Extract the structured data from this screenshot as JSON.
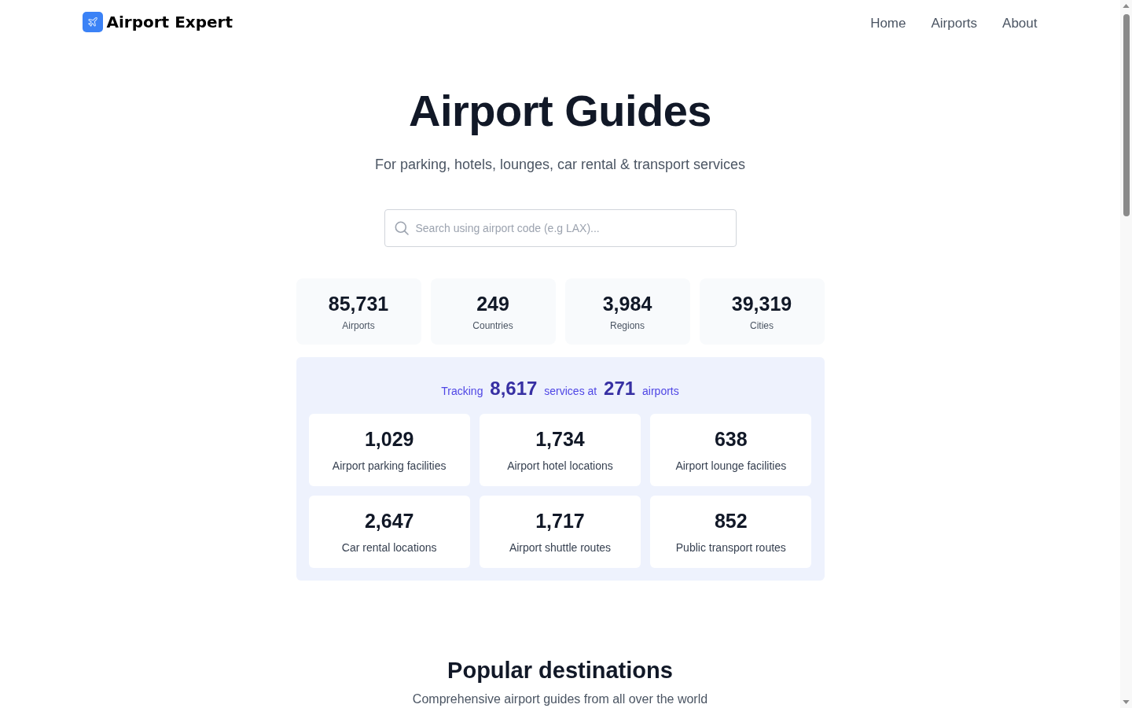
{
  "header": {
    "logo": {
      "text": "Airport Expert"
    },
    "nav": [
      {
        "label": "Home"
      },
      {
        "label": "Airports"
      },
      {
        "label": "About"
      }
    ]
  },
  "hero": {
    "title": "Airport Guides",
    "subtitle": "For parking, hotels, lounges, car rental & transport services",
    "search": {
      "placeholder": "Search using airport code (e.g LAX)..."
    }
  },
  "stats": [
    {
      "value": "85,731",
      "label": "Airports"
    },
    {
      "value": "249",
      "label": "Countries"
    },
    {
      "value": "3,984",
      "label": "Regions"
    },
    {
      "value": "39,319",
      "label": "Cities"
    }
  ],
  "services": {
    "summary": "Tracking **8,617** services at **271** airports",
    "cards": [
      {
        "value": "1,029",
        "label": "Airport parking facilities"
      },
      {
        "value": "1,734",
        "label": "Airport hotel locations"
      },
      {
        "value": "638",
        "label": "Airport lounge facilities"
      },
      {
        "value": "2,647",
        "label": "Car rental locations"
      },
      {
        "value": "1,717",
        "label": "Airport shuttle routes"
      },
      {
        "value": "852",
        "label": "Public transport routes"
      }
    ]
  },
  "popular": {
    "title": "Popular destinations",
    "subtitle": "Comprehensive airport guides from all over the world"
  }
}
